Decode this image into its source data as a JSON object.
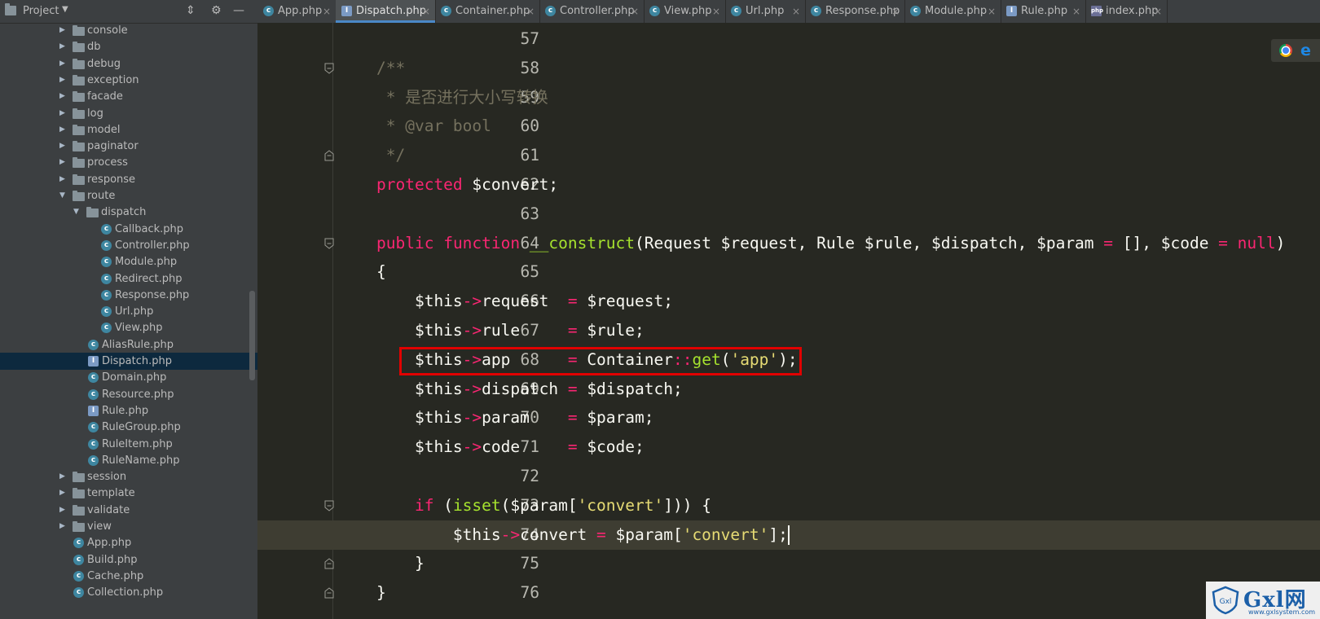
{
  "sidebar": {
    "title": "Project",
    "tree": [
      {
        "label": "console",
        "type": "folder",
        "depth": 0,
        "expanded": false
      },
      {
        "label": "db",
        "type": "folder",
        "depth": 0,
        "expanded": false
      },
      {
        "label": "debug",
        "type": "folder",
        "depth": 0,
        "expanded": false
      },
      {
        "label": "exception",
        "type": "folder",
        "depth": 0,
        "expanded": false
      },
      {
        "label": "facade",
        "type": "folder",
        "depth": 0,
        "expanded": false
      },
      {
        "label": "log",
        "type": "folder",
        "depth": 0,
        "expanded": false
      },
      {
        "label": "model",
        "type": "folder",
        "depth": 0,
        "expanded": false
      },
      {
        "label": "paginator",
        "type": "folder",
        "depth": 0,
        "expanded": false
      },
      {
        "label": "process",
        "type": "folder",
        "depth": 0,
        "expanded": false
      },
      {
        "label": "response",
        "type": "folder",
        "depth": 0,
        "expanded": false
      },
      {
        "label": "route",
        "type": "folder",
        "depth": 0,
        "expanded": true
      },
      {
        "label": "dispatch",
        "type": "folder",
        "depth": 1,
        "expanded": true
      },
      {
        "label": "Callback.php",
        "type": "class",
        "depth": 2
      },
      {
        "label": "Controller.php",
        "type": "class",
        "depth": 2
      },
      {
        "label": "Module.php",
        "type": "class",
        "depth": 2
      },
      {
        "label": "Redirect.php",
        "type": "class",
        "depth": 2
      },
      {
        "label": "Response.php",
        "type": "class",
        "depth": 2
      },
      {
        "label": "Url.php",
        "type": "class",
        "depth": 2
      },
      {
        "label": "View.php",
        "type": "class",
        "depth": 2
      },
      {
        "label": "AliasRule.php",
        "type": "class",
        "depth": 1
      },
      {
        "label": "Dispatch.php",
        "type": "interface",
        "depth": 1,
        "selected": true
      },
      {
        "label": "Domain.php",
        "type": "class",
        "depth": 1
      },
      {
        "label": "Resource.php",
        "type": "class",
        "depth": 1
      },
      {
        "label": "Rule.php",
        "type": "interface",
        "depth": 1
      },
      {
        "label": "RuleGroup.php",
        "type": "class",
        "depth": 1
      },
      {
        "label": "RuleItem.php",
        "type": "class",
        "depth": 1
      },
      {
        "label": "RuleName.php",
        "type": "class",
        "depth": 1
      },
      {
        "label": "session",
        "type": "folder",
        "depth": 0,
        "expanded": false
      },
      {
        "label": "template",
        "type": "folder",
        "depth": 0,
        "expanded": false
      },
      {
        "label": "validate",
        "type": "folder",
        "depth": 0,
        "expanded": false
      },
      {
        "label": "view",
        "type": "folder",
        "depth": 0,
        "expanded": false
      },
      {
        "label": "App.php",
        "type": "class",
        "depth": 0
      },
      {
        "label": "Build.php",
        "type": "class",
        "depth": 0
      },
      {
        "label": "Cache.php",
        "type": "class",
        "depth": 0
      },
      {
        "label": "Collection.php",
        "type": "class",
        "depth": 0
      }
    ]
  },
  "tabs": [
    {
      "label": "App.php",
      "icon": "class",
      "active": false
    },
    {
      "label": "Dispatch.php",
      "icon": "interface",
      "active": true
    },
    {
      "label": "Container.php",
      "icon": "class",
      "active": false
    },
    {
      "label": "Controller.php",
      "icon": "class",
      "active": false
    },
    {
      "label": "View.php",
      "icon": "class",
      "active": false
    },
    {
      "label": "Url.php",
      "icon": "class",
      "active": false
    },
    {
      "label": "Response.php",
      "icon": "class",
      "active": false
    },
    {
      "label": "Module.php",
      "icon": "class",
      "active": false
    },
    {
      "label": "Rule.php",
      "icon": "interface",
      "active": false
    },
    {
      "label": "index.php",
      "icon": "php",
      "active": false
    }
  ],
  "editor": {
    "lines": [
      {
        "n": "57",
        "tokens": []
      },
      {
        "n": "58",
        "fold": "open",
        "tokens": [
          [
            "comment",
            "/**"
          ]
        ]
      },
      {
        "n": "59",
        "tokens": [
          [
            "comment",
            " * 是否进行大小写转换"
          ]
        ]
      },
      {
        "n": "60",
        "tokens": [
          [
            "comment",
            " * @var bool"
          ]
        ]
      },
      {
        "n": "61",
        "fold": "close",
        "tokens": [
          [
            "comment",
            " */"
          ]
        ]
      },
      {
        "n": "62",
        "tokens": [
          [
            "kw",
            "protected"
          ],
          [
            "plain",
            " $convert;"
          ]
        ]
      },
      {
        "n": "63",
        "tokens": []
      },
      {
        "n": "64",
        "fold": "open",
        "tokens": [
          [
            "kw",
            "public"
          ],
          [
            "plain",
            " "
          ],
          [
            "kw",
            "function"
          ],
          [
            "plain",
            " "
          ],
          [
            "fn",
            "__construct"
          ],
          [
            "plain",
            "(Request $request, Rule $rule, $dispatch, $param "
          ],
          [
            "kw",
            "="
          ],
          [
            "plain",
            " [], $code "
          ],
          [
            "kw",
            "="
          ],
          [
            "plain",
            " "
          ],
          [
            "kw",
            "null"
          ],
          [
            "plain",
            ")"
          ]
        ]
      },
      {
        "n": "65",
        "tokens": [
          [
            "plain",
            "{"
          ]
        ]
      },
      {
        "n": "66",
        "tokens": [
          [
            "plain",
            "    $this"
          ],
          [
            "kw",
            "->"
          ],
          [
            "plain",
            "request  "
          ],
          [
            "kw",
            "="
          ],
          [
            "plain",
            " $request;"
          ]
        ]
      },
      {
        "n": "67",
        "tokens": [
          [
            "plain",
            "    $this"
          ],
          [
            "kw",
            "->"
          ],
          [
            "plain",
            "rule     "
          ],
          [
            "kw",
            "="
          ],
          [
            "plain",
            " $rule;"
          ]
        ]
      },
      {
        "n": "68",
        "tokens": [
          [
            "plain",
            "    $this"
          ],
          [
            "kw",
            "->"
          ],
          [
            "plain",
            "app      "
          ],
          [
            "kw",
            "="
          ],
          [
            "plain",
            " Container"
          ],
          [
            "kw",
            "::"
          ],
          [
            "fn",
            "get"
          ],
          [
            "plain",
            "("
          ],
          [
            "str",
            "'app'"
          ],
          [
            "plain",
            ");"
          ]
        ]
      },
      {
        "n": "69",
        "tokens": [
          [
            "plain",
            "    $this"
          ],
          [
            "kw",
            "->"
          ],
          [
            "plain",
            "dispatch "
          ],
          [
            "kw",
            "="
          ],
          [
            "plain",
            " $dispatch;"
          ]
        ]
      },
      {
        "n": "70",
        "tokens": [
          [
            "plain",
            "    $this"
          ],
          [
            "kw",
            "->"
          ],
          [
            "plain",
            "param    "
          ],
          [
            "kw",
            "="
          ],
          [
            "plain",
            " $param;"
          ]
        ]
      },
      {
        "n": "71",
        "tokens": [
          [
            "plain",
            "    $this"
          ],
          [
            "kw",
            "->"
          ],
          [
            "plain",
            "code     "
          ],
          [
            "kw",
            "="
          ],
          [
            "plain",
            " $code;"
          ]
        ]
      },
      {
        "n": "72",
        "tokens": []
      },
      {
        "n": "73",
        "fold": "open",
        "tokens": [
          [
            "plain",
            "    "
          ],
          [
            "kw",
            "if"
          ],
          [
            "plain",
            " ("
          ],
          [
            "fn",
            "isset"
          ],
          [
            "plain",
            "($param["
          ],
          [
            "str",
            "'convert'"
          ],
          [
            "plain",
            "])) {"
          ]
        ]
      },
      {
        "n": "74",
        "current": true,
        "tokens": [
          [
            "plain",
            "        $this"
          ],
          [
            "kw",
            "->"
          ],
          [
            "plain",
            "convert "
          ],
          [
            "kw",
            "="
          ],
          [
            "plain",
            " $param["
          ],
          [
            "str",
            "'convert'"
          ],
          [
            "plain",
            "];"
          ]
        ]
      },
      {
        "n": "75",
        "fold": "close",
        "tokens": [
          [
            "plain",
            "    }"
          ]
        ]
      },
      {
        "n": "76",
        "fold": "close",
        "tokens": [
          [
            "plain",
            "}"
          ]
        ]
      }
    ]
  },
  "watermark": {
    "text": "Gxl网",
    "sub": "www.gxlsystem.com",
    "shield_text": "Gxl"
  },
  "colors": {
    "background": "#272822",
    "keyword": "#f92672",
    "function": "#a6e22e",
    "string": "#e6db74",
    "comment": "#75715e",
    "highlight_box": "#e10000",
    "tab_active_underline": "#4a88c7"
  }
}
